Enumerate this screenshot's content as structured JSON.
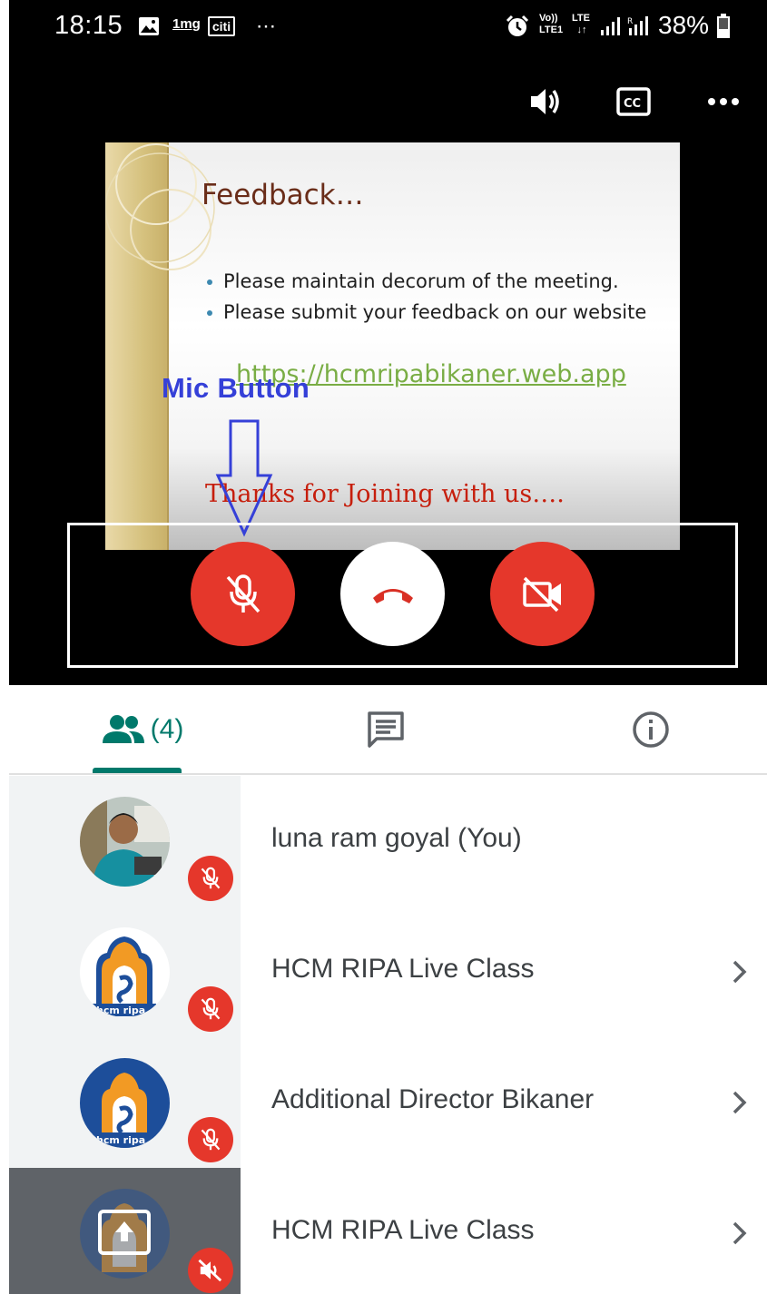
{
  "status_bar": {
    "time": "18:15",
    "icons": [
      "gallery-icon",
      "1mg-notification",
      "citi-notification",
      "more-dots"
    ],
    "notif_1mg": "1mg",
    "notif_citi": "citi",
    "net_volte": "Vo))",
    "net_lte1": "LTE1",
    "net_lte": "LTE",
    "battery_percent": "38%"
  },
  "top_controls": {
    "icons": [
      "speaker-icon",
      "closed-captions-icon",
      "more-options-icon"
    ]
  },
  "slide": {
    "title": "Feedback…",
    "bullets": [
      "Please maintain decorum of the meeting.",
      "Please submit your feedback on our website"
    ],
    "link": "https://hcmripabikaner.web.app",
    "thanks": "Thanks for Joining with us…."
  },
  "annotation": {
    "label": "Mic Button"
  },
  "call_controls": {
    "buttons": [
      "mic-off",
      "end-call",
      "camera-off"
    ],
    "colors": {
      "red": "#e5372b",
      "white": "#ffffff"
    }
  },
  "tabs": {
    "people_count": "(4)",
    "active": "people",
    "accent": "#00796b"
  },
  "participants": [
    {
      "name": "luna ram goyal (You)",
      "muted": true,
      "has_chevron": false,
      "avatar": "photo"
    },
    {
      "name": "HCM RIPA Live Class",
      "muted": true,
      "has_chevron": true,
      "avatar": "hcm-ripa-logo"
    },
    {
      "name": "Additional Director Bikaner",
      "muted": true,
      "has_chevron": true,
      "avatar": "hcm-ripa-logo"
    },
    {
      "name": "HCM RIPA Live Class",
      "muted": true,
      "has_chevron": true,
      "avatar": "presenting"
    }
  ],
  "logo_text": "hcm ripa"
}
